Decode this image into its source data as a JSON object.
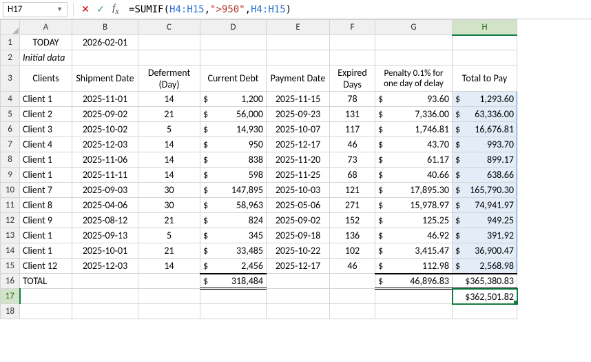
{
  "name_box": "H17",
  "formula_parts": {
    "eq": "=",
    "fn": "SUMIF",
    "open": "(",
    "ref1": "H4:H15",
    "comma1": ",",
    "str": "\">950\"",
    "comma2": ",",
    "ref2": "H4:H15",
    "close": ")"
  },
  "columns": [
    "A",
    "B",
    "C",
    "D",
    "E",
    "F",
    "G",
    "H"
  ],
  "row_headers": [
    "1",
    "2",
    "3",
    "4",
    "5",
    "6",
    "7",
    "8",
    "9",
    "10",
    "11",
    "12",
    "13",
    "14",
    "15",
    "16",
    "17",
    "18"
  ],
  "r1": {
    "a": "TODAY",
    "b": "2026-02-01"
  },
  "r2": {
    "a": "Initial data"
  },
  "headers": {
    "a": "Clients",
    "b": "Shipment Date",
    "c": "Deferment (Day)",
    "d": "Current Debt",
    "e": "Payment Date",
    "f": "Expired Days",
    "g": "Penalty 0.1% for one day of delay",
    "h": "Total to Pay"
  },
  "rows": [
    {
      "a": "Client 1",
      "b": "2025-11-01",
      "c": "14",
      "d": "1,200",
      "e": "2025-11-15",
      "f": "78",
      "g": "93.60",
      "h": "1,293.60"
    },
    {
      "a": "Client 2",
      "b": "2025-09-02",
      "c": "21",
      "d": "56,000",
      "e": "2025-09-23",
      "f": "131",
      "g": "7,336.00",
      "h": "63,336.00"
    },
    {
      "a": "Client 3",
      "b": "2025-10-02",
      "c": "5",
      "d": "14,930",
      "e": "2025-10-07",
      "f": "117",
      "g": "1,746.81",
      "h": "16,676.81"
    },
    {
      "a": "Client 4",
      "b": "2025-12-03",
      "c": "14",
      "d": "950",
      "e": "2025-12-17",
      "f": "46",
      "g": "43.70",
      "h": "993.70"
    },
    {
      "a": "Client 1",
      "b": "2025-11-06",
      "c": "14",
      "d": "838",
      "e": "2025-11-20",
      "f": "73",
      "g": "61.17",
      "h": "899.17"
    },
    {
      "a": "Client 1",
      "b": "2025-11-11",
      "c": "14",
      "d": "598",
      "e": "2025-11-25",
      "f": "68",
      "g": "40.66",
      "h": "638.66"
    },
    {
      "a": "Client 7",
      "b": "2025-09-03",
      "c": "30",
      "d": "147,895",
      "e": "2025-10-03",
      "f": "121",
      "g": "17,895.30",
      "h": "165,790.30"
    },
    {
      "a": "Client 8",
      "b": "2025-04-06",
      "c": "30",
      "d": "58,963",
      "e": "2025-05-06",
      "f": "271",
      "g": "15,978.97",
      "h": "74,941.97"
    },
    {
      "a": "Client 9",
      "b": "2025-08-12",
      "c": "21",
      "d": "824",
      "e": "2025-09-02",
      "f": "152",
      "g": "125.25",
      "h": "949.25"
    },
    {
      "a": "Client 1",
      "b": "2025-09-13",
      "c": "5",
      "d": "345",
      "e": "2025-09-18",
      "f": "136",
      "g": "46.92",
      "h": "391.92"
    },
    {
      "a": "Client 1",
      "b": "2025-10-01",
      "c": "21",
      "d": "33,485",
      "e": "2025-10-22",
      "f": "102",
      "g": "3,415.47",
      "h": "36,900.47"
    },
    {
      "a": "Client 12",
      "b": "2025-12-03",
      "c": "14",
      "d": "2,456",
      "e": "2025-12-17",
      "f": "46",
      "g": "112.98",
      "h": "2,568.98"
    }
  ],
  "total": {
    "label": "TOTAL",
    "d": "318,484",
    "g": "46,896.83",
    "h": "$365,380.83"
  },
  "h17": "$362,501.82",
  "sym": "$"
}
